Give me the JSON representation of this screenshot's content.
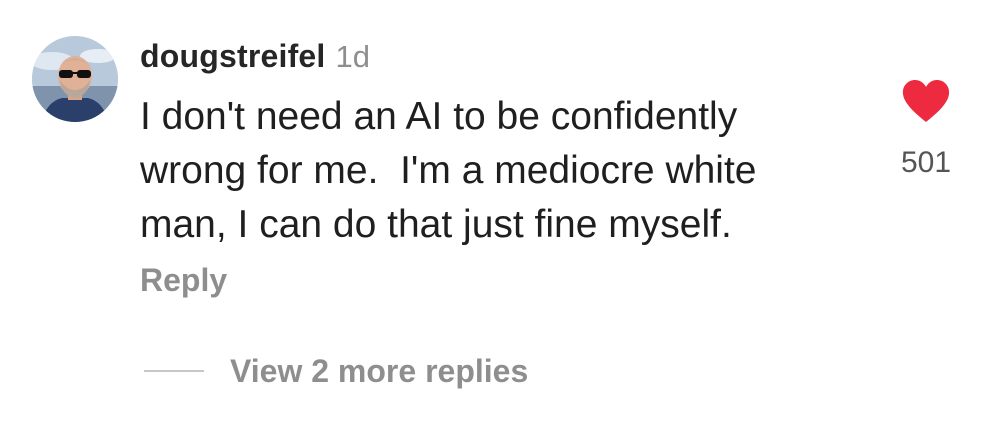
{
  "comment": {
    "username": "dougstreifel",
    "timestamp": "1d",
    "text": "I don't need an AI to be confidently\nwrong for me.  I'm a mediocre white\nman, I can do that just fine myself.",
    "like_icon": "heart-filled-icon",
    "like_color": "#ed2a3f",
    "like_count": "501",
    "reply_label": "Reply",
    "view_replies_label": "View 2 more replies"
  }
}
